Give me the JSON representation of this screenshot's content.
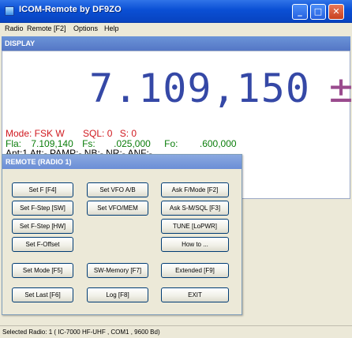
{
  "window": {
    "title": "ICOM-Remote by DF9ZO"
  },
  "menu": [
    {
      "label": "Radio"
    },
    {
      "label": "Remote [F2]"
    },
    {
      "label": "Options"
    },
    {
      "label": "Help"
    }
  ],
  "display": {
    "header": "DISPLAY",
    "frequency": "7.109,150",
    "frequency_suffix": "±",
    "mode": "Mode: FSK W",
    "sql": "SQL: 0",
    "s": "S: 0",
    "fla_label": "Fla:",
    "fla_value": "7.109,140",
    "fs_label": "Fs:",
    "fs_value": ".025,000",
    "fo_label": "Fo:",
    "fo_value": ".600,000",
    "ant_line": "Ant:1  Att:-  PAMP:-  NB:-  NR:-  ANF:-"
  },
  "remote": {
    "title": "REMOTE (RADIO 1)",
    "buttons": {
      "set_f": "Set F [F4]",
      "set_vfo_ab": "Set VFO A/B",
      "ask_f_mode": "Ask F/Mode [F2]",
      "set_fstep_sw": "Set F-Step [SW]",
      "set_vfo_mem": "Set VFO/MEM",
      "ask_smsql": "Ask S-M/SQL [F3]",
      "set_fstep_hw": "Set F-Step [HW]",
      "tune": "TUNE [LoPWR]",
      "set_foffset": "Set F-Offset",
      "howto": "How to ...",
      "set_mode": "Set Mode [F5]",
      "sw_memory": "SW-Memory [F7]",
      "extended": "Extended [F9]",
      "set_last": "Set Last [F6]",
      "log": "Log [F8]",
      "exit": "EXIT"
    }
  },
  "status": {
    "text": "Selected Radio: 1 ( IC-7000 HF-UHF , COM1 , 9600 Bd)"
  },
  "colors": {
    "frequency": "#3548a6",
    "mode_line": "#d0191f",
    "fla_line": "#0a7d0a"
  }
}
